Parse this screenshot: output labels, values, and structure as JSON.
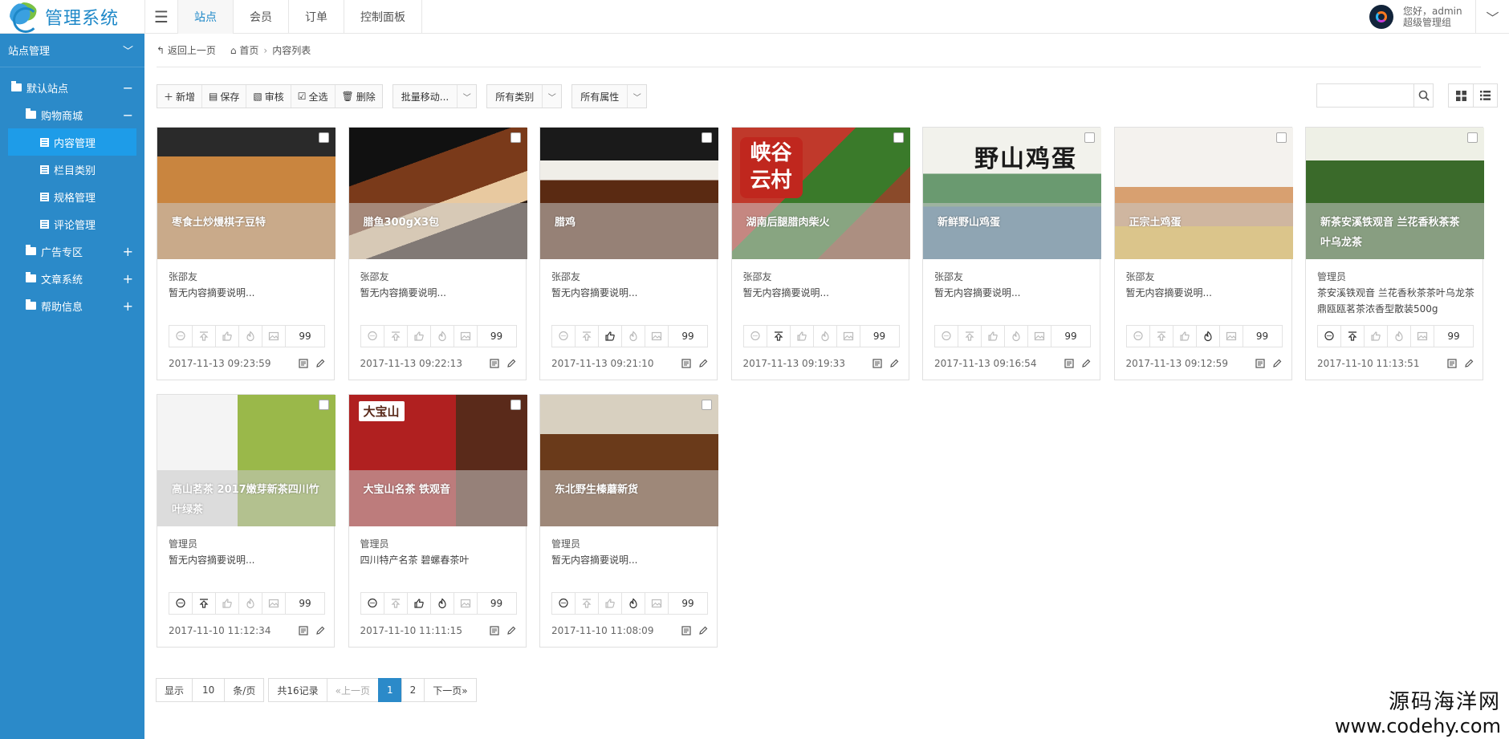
{
  "app": {
    "title": "管理系统"
  },
  "top_tabs": [
    {
      "label": "站点",
      "active": true
    },
    {
      "label": "会员",
      "active": false
    },
    {
      "label": "订单",
      "active": false
    },
    {
      "label": "控制面板",
      "active": false
    }
  ],
  "user": {
    "greeting": "您好，admin",
    "role": "超级管理组"
  },
  "sidebar": {
    "header": "站点管理",
    "items": [
      {
        "label": "默认站点",
        "level": 1,
        "type": "folder",
        "toggle": "−"
      },
      {
        "label": "购物商城",
        "level": 2,
        "type": "folder",
        "toggle": "−"
      },
      {
        "label": "内容管理",
        "level": 3,
        "type": "doc",
        "active": true
      },
      {
        "label": "栏目类别",
        "level": 3,
        "type": "doc"
      },
      {
        "label": "规格管理",
        "level": 3,
        "type": "doc"
      },
      {
        "label": "评论管理",
        "level": 3,
        "type": "doc"
      },
      {
        "label": "广告专区",
        "level": 2,
        "type": "folder",
        "toggle": "+"
      },
      {
        "label": "文章系统",
        "level": 2,
        "type": "folder",
        "toggle": "+"
      },
      {
        "label": "帮助信息",
        "level": 2,
        "type": "folder",
        "toggle": "+"
      }
    ]
  },
  "breadcrumb": {
    "back": "返回上一页",
    "home": "首页",
    "current": "内容列表"
  },
  "toolbar": {
    "buttons": [
      {
        "label": "新增",
        "icon": "plus-icon"
      },
      {
        "label": "保存",
        "icon": "save-icon"
      },
      {
        "label": "审核",
        "icon": "audit-icon"
      },
      {
        "label": "全选",
        "icon": "check-icon"
      },
      {
        "label": "删除",
        "icon": "trash-icon"
      }
    ],
    "selects": [
      "批量移动...",
      "所有类别",
      "所有属性"
    ]
  },
  "search": {
    "placeholder": ""
  },
  "cards": [
    {
      "title": "枣食土炒熳棋子豆特",
      "author": "张邵友",
      "desc": "暂无内容摘要说明...",
      "count": "99",
      "date": "2017-11-13 09:23:59",
      "theme": "beans"
    },
    {
      "title": "腊鱼300gX3包",
      "author": "张邵友",
      "desc": "暂无内容摘要说明...",
      "count": "99",
      "date": "2017-11-13 09:22:13",
      "theme": "fish"
    },
    {
      "title": "腊鸡",
      "author": "张邵友",
      "desc": "暂无内容摘要说明...",
      "count": "99",
      "date": "2017-11-13 09:21:10",
      "theme": "chicken"
    },
    {
      "title": "湖南后腿腊肉柴火",
      "author": "张邵友",
      "desc": "暂无内容摘要说明...",
      "count": "99",
      "date": "2017-11-13 09:19:33",
      "theme": "seal",
      "seal": [
        "峡",
        "谷",
        "云",
        "村"
      ]
    },
    {
      "title": "新鲜野山鸡蛋",
      "author": "张邵友",
      "desc": "暂无内容摘要说明...",
      "count": "99",
      "date": "2017-11-13 09:16:54",
      "theme": "landscape",
      "brand": "野山鸡蛋"
    },
    {
      "title": "正宗土鸡蛋",
      "author": "张邵友",
      "desc": "暂无内容摘要说明...",
      "count": "99",
      "date": "2017-11-13 09:12:59",
      "theme": "eggs"
    },
    {
      "title": "新茶安溪铁观音 兰花香秋茶茶叶乌龙茶",
      "author": "管理员",
      "desc": "茶安溪铁观音 兰花香秋茶茶叶乌龙茶鼎瓯瓯茗茶浓香型散装500g",
      "count": "99",
      "date": "2017-11-10 11:13:51",
      "theme": "tea"
    },
    {
      "title": "高山茗茶 2017嫩芽新茶四川竹叶绿茶",
      "author": "管理员",
      "desc": "暂无内容摘要说明...",
      "count": "99",
      "date": "2017-11-10 11:12:34",
      "theme": "greentea"
    },
    {
      "title": "大宝山名茶 铁观音",
      "author": "管理员",
      "desc": "四川特产名茶 碧螺春茶叶",
      "count": "99",
      "date": "2017-11-10 11:11:15",
      "theme": "redbox",
      "brand": "大宝山"
    },
    {
      "title": "东北野生榛蘑新货",
      "author": "管理员",
      "desc": "暂无内容摘要说明...",
      "count": "99",
      "date": "2017-11-10 11:08:09",
      "theme": "mushroom"
    }
  ],
  "pager": {
    "show": "显示",
    "page_size": "10",
    "per_page": "条/页",
    "total": "共16记录",
    "prev": "«上一页",
    "pages": [
      "1",
      "2"
    ],
    "current": "1",
    "next": "下一页»"
  },
  "watermark": {
    "line1": "源码海洋网",
    "line2": "www.codehy.com"
  },
  "colors": {
    "sidebar": "#2b8ac9",
    "accent": "#1e88c8",
    "active_item": "#1e9ce8"
  }
}
